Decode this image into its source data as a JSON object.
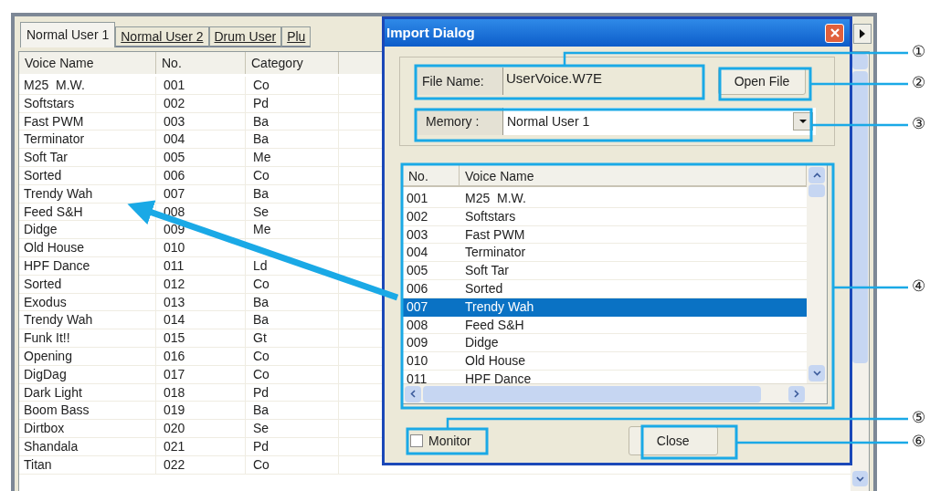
{
  "main_window": {
    "tabs": [
      {
        "label": "Normal User 1",
        "selected": true
      },
      {
        "label": "Normal User 2",
        "selected": false
      },
      {
        "label": "Drum User",
        "selected": false
      },
      {
        "label": "Plu",
        "selected": false
      }
    ],
    "table": {
      "columns": [
        "Voice Name",
        "No.",
        "Category"
      ],
      "rows": [
        {
          "name": "M25  M.W.",
          "no": "001",
          "category": "Co"
        },
        {
          "name": "Softstars",
          "no": "002",
          "category": "Pd"
        },
        {
          "name": "Fast PWM",
          "no": "003",
          "category": "Ba"
        },
        {
          "name": "Terminator",
          "no": "004",
          "category": "Ba"
        },
        {
          "name": "Soft Tar",
          "no": "005",
          "category": "Me"
        },
        {
          "name": "Sorted",
          "no": "006",
          "category": "Co"
        },
        {
          "name": "Trendy Wah",
          "no": "007",
          "category": "Ba"
        },
        {
          "name": "Feed S&H",
          "no": "008",
          "category": "Se"
        },
        {
          "name": "Didge",
          "no": "009",
          "category": "Me"
        },
        {
          "name": "Old House",
          "no": "010"
        },
        {
          "name": "HPF Dance",
          "no": "011",
          "category": "Ld"
        },
        {
          "name": "Sorted",
          "no": "012",
          "category": "Co"
        },
        {
          "name": "Exodus",
          "no": "013",
          "category": "Ba"
        },
        {
          "name": "Trendy Wah",
          "no": "014",
          "category": "Ba"
        },
        {
          "name": "Funk It!!",
          "no": "015",
          "category": "Gt"
        },
        {
          "name": "Opening",
          "no": "016",
          "category": "Co"
        },
        {
          "name": "DigDag",
          "no": "017",
          "category": "Co"
        },
        {
          "name": "Dark Light",
          "no": "018",
          "category": "Pd"
        },
        {
          "name": "Boom Bass",
          "no": "019",
          "category": "Ba"
        },
        {
          "name": "Dirtbox",
          "no": "020",
          "category": "Se"
        },
        {
          "name": "Shandala",
          "no": "021",
          "category": "Pd"
        },
        {
          "name": "Titan",
          "no": "022",
          "category": "Co"
        }
      ]
    }
  },
  "import_dialog": {
    "title": "Import Dialog",
    "file_name_label": "File Name:",
    "file_name": "UserVoice.W7E",
    "open_file_button": "Open File",
    "memory_label": "Memory :",
    "memory_value": "Normal User 1",
    "list": {
      "columns": [
        "No.",
        "Voice Name"
      ],
      "rows": [
        {
          "no": "001",
          "name": "M25  M.W.",
          "selected": false
        },
        {
          "no": "002",
          "name": "Softstars",
          "selected": false
        },
        {
          "no": "003",
          "name": "Fast PWM",
          "selected": false
        },
        {
          "no": "004",
          "name": "Terminator",
          "selected": false
        },
        {
          "no": "005",
          "name": "Soft Tar",
          "selected": false
        },
        {
          "no": "006",
          "name": "Sorted",
          "selected": false
        },
        {
          "no": "007",
          "name": "Trendy Wah",
          "selected": true
        },
        {
          "no": "008",
          "name": "Feed S&H",
          "selected": false
        },
        {
          "no": "009",
          "name": "Didge",
          "selected": false
        },
        {
          "no": "010",
          "name": "Old House",
          "selected": false
        },
        {
          "no": "011",
          "name": "HPF Dance",
          "selected": false
        }
      ]
    },
    "monitor": {
      "label": "Monitor",
      "checked": false
    },
    "close_button": "Close"
  },
  "callouts": [
    "①",
    "②",
    "③",
    "④",
    "⑤",
    "⑥"
  ]
}
